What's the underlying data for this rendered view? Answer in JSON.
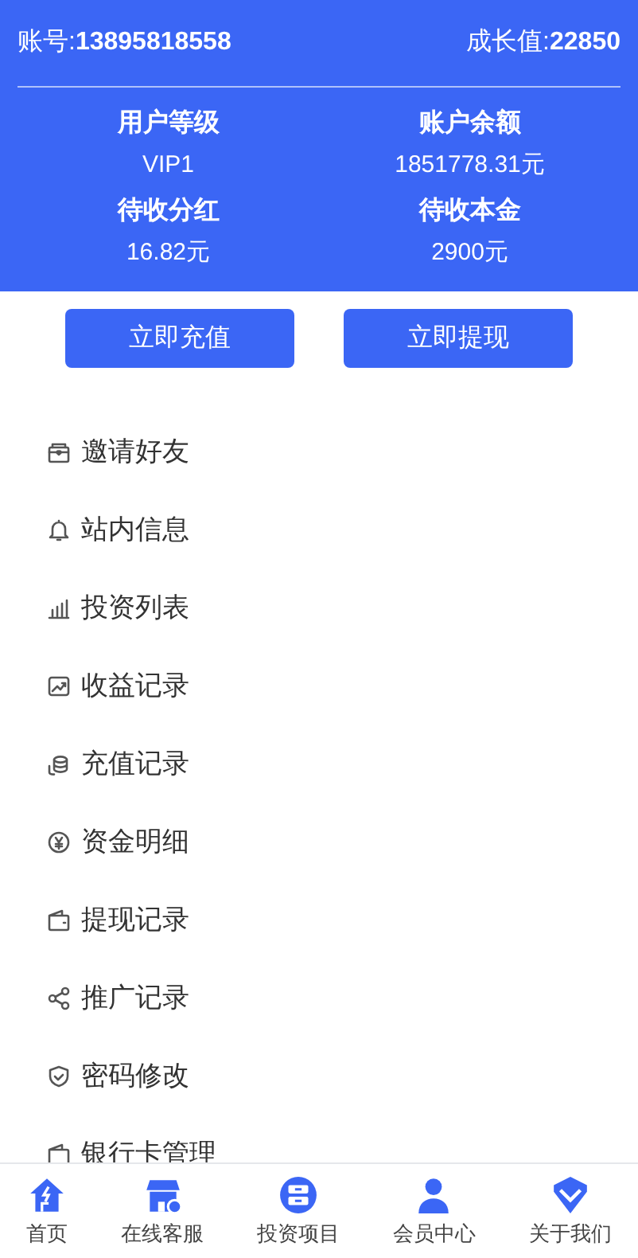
{
  "header": {
    "account_label": "账号:",
    "account": "13895818558",
    "growth_label": "成长值:",
    "growth": "22850",
    "stats": [
      {
        "label": "用户等级",
        "value": "VIP1"
      },
      {
        "label": "账户余额",
        "value": "1851778.31元"
      },
      {
        "label": "待收分红",
        "value": "16.82元"
      },
      {
        "label": "待收本金",
        "value": "2900元"
      }
    ]
  },
  "buttons": [
    "立即充值",
    "立即提现"
  ],
  "menu": [
    "邀请好友",
    "站内信息",
    "投资列表",
    "收益记录",
    "充值记录",
    "资金明细",
    "提现记录",
    "推广记录",
    "密码修改",
    "银行卡管理"
  ],
  "tab_bar": [
    {
      "label": "首页"
    },
    {
      "label": "在线客服"
    },
    {
      "label": "投资项目"
    },
    {
      "label": "会员中心"
    },
    {
      "label": "关于我们"
    }
  ]
}
